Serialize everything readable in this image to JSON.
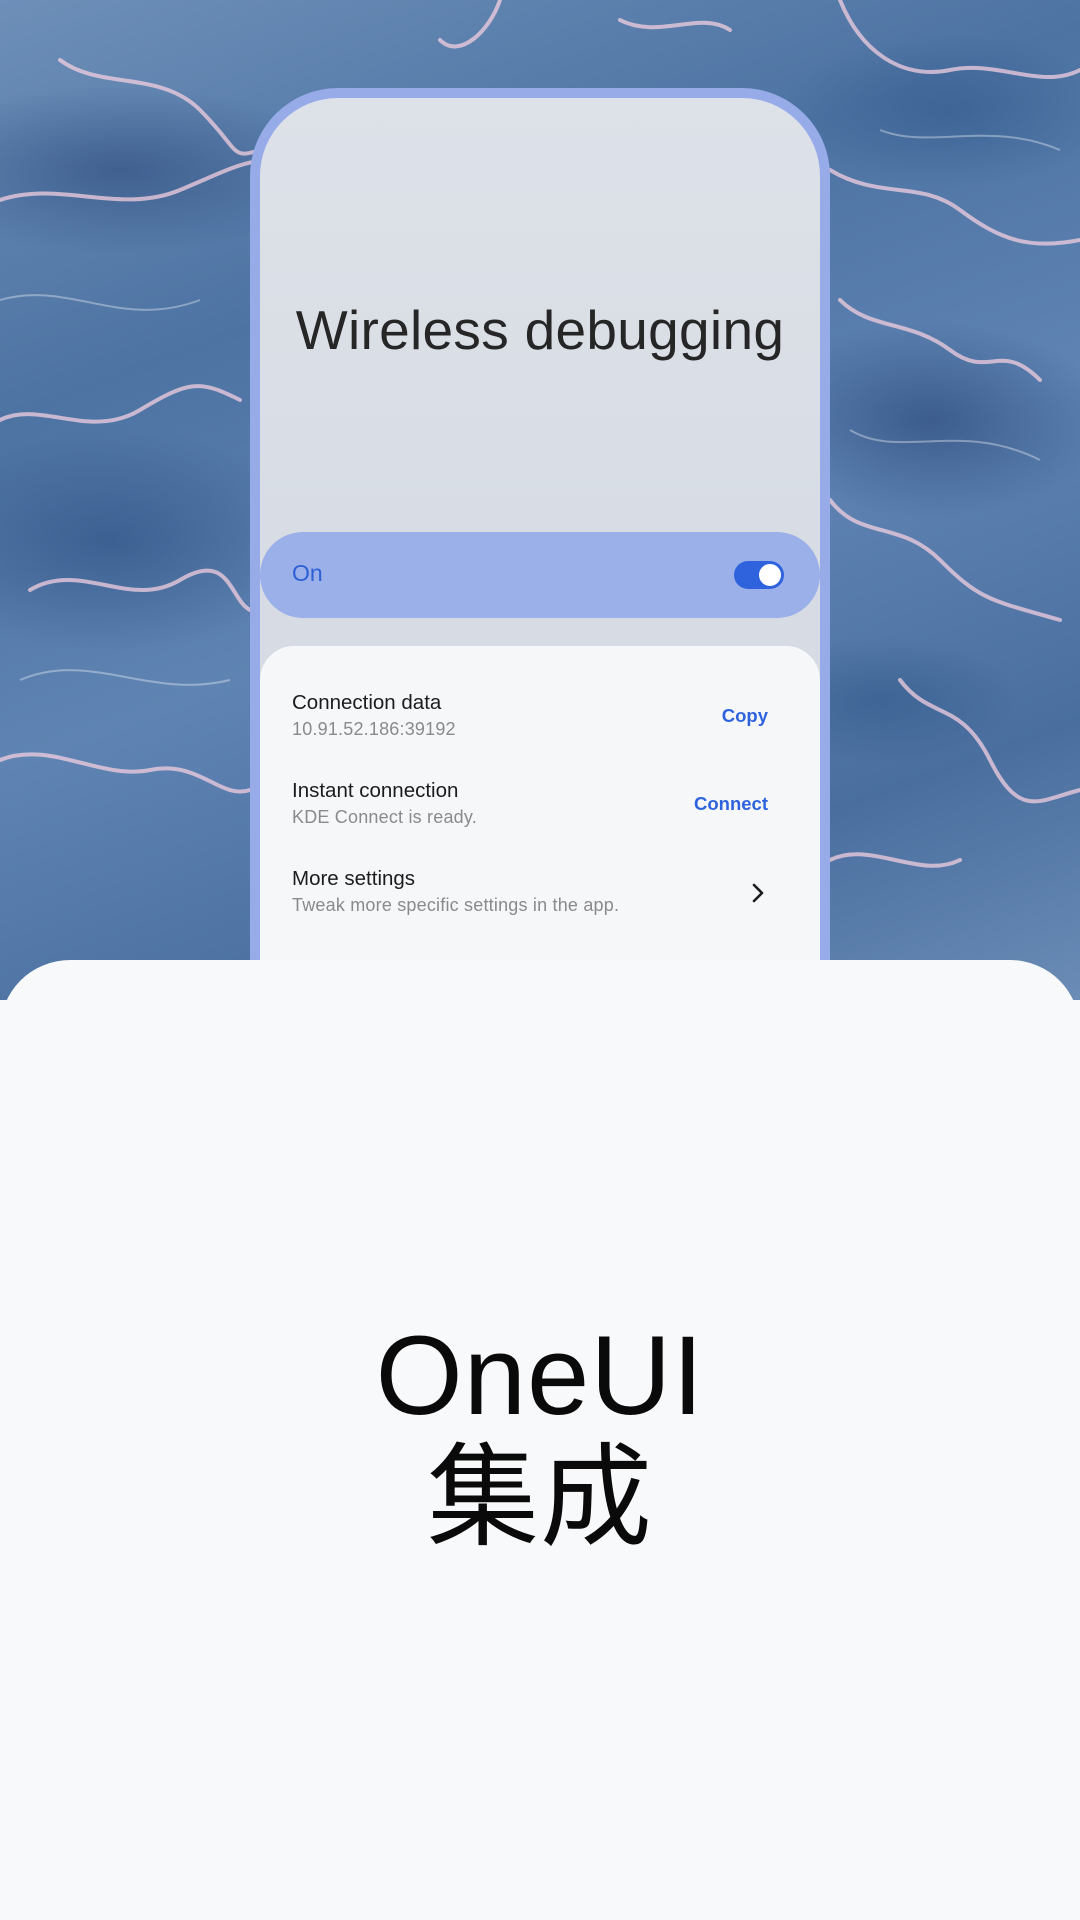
{
  "screen": {
    "title": "Wireless debugging",
    "toggle": {
      "label": "On",
      "state": "on"
    },
    "rows": [
      {
        "title": "Connection data",
        "subtitle": "10.91.52.186:39192",
        "action": "Copy"
      },
      {
        "title": "Instant connection",
        "subtitle": "KDE Connect is ready.",
        "action": "Connect"
      },
      {
        "title": "More settings",
        "subtitle": "Tweak more specific settings in the app.",
        "icon": "chevron-right-icon"
      }
    ]
  },
  "sheet": {
    "line1": "OneUI",
    "line2": "集成"
  },
  "colors": {
    "accent": "#2f63de",
    "phone_frame": "#97abe8",
    "toggle_bar": "#9bafe8",
    "sheet_bg": "#f8f9fa"
  }
}
